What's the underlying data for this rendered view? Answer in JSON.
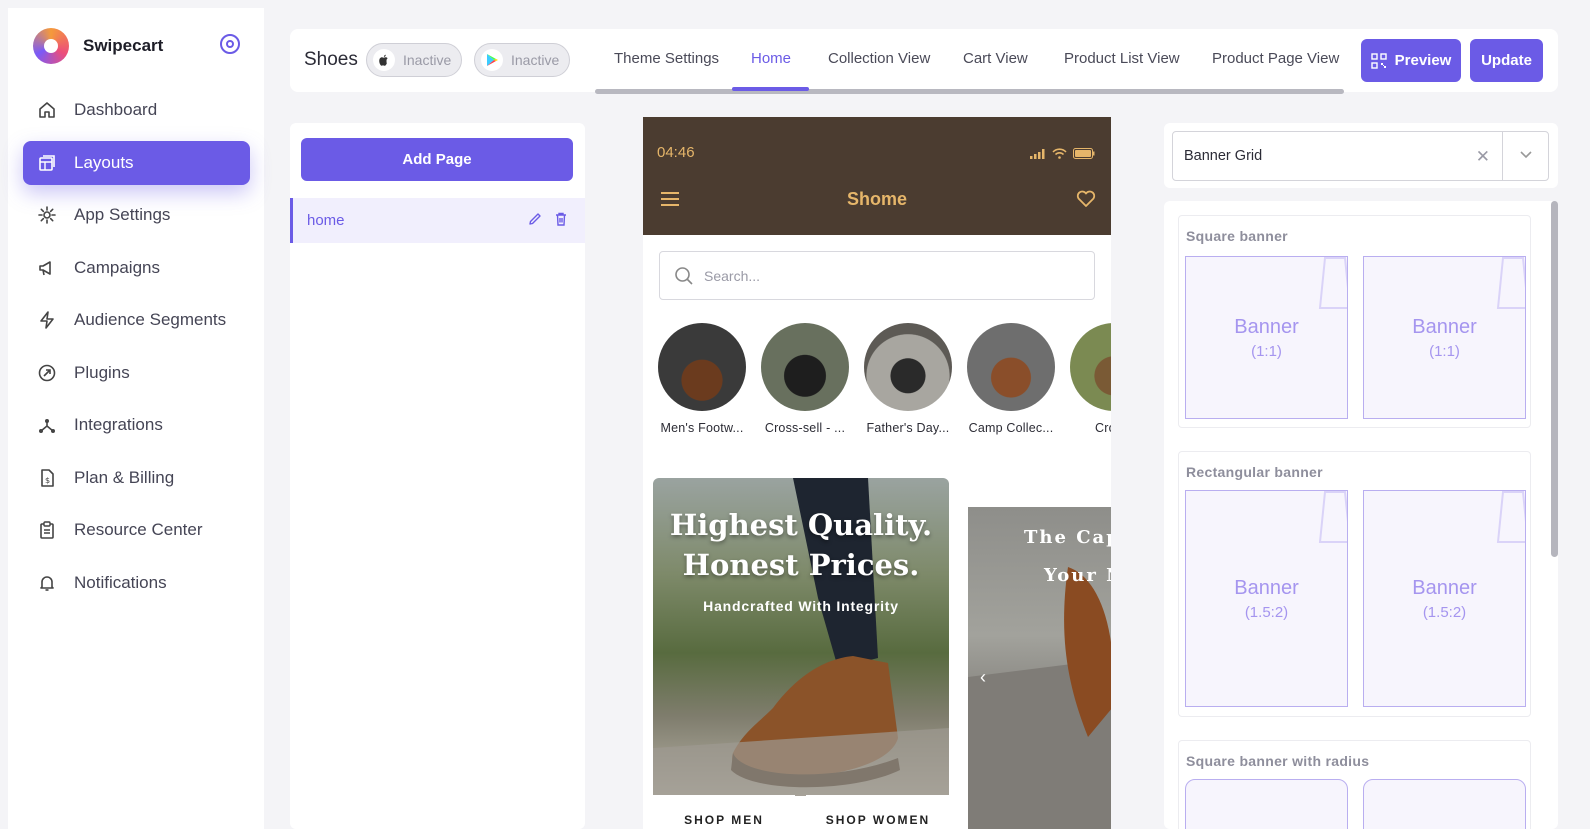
{
  "brand": {
    "name": "Swipecart"
  },
  "sidebar": {
    "items": [
      {
        "label": "Dashboard",
        "icon": "home-icon",
        "active": false
      },
      {
        "label": "Layouts",
        "icon": "layouts-icon",
        "active": true
      },
      {
        "label": "App Settings",
        "icon": "gear-icon",
        "active": false
      },
      {
        "label": "Campaigns",
        "icon": "megaphone-icon",
        "active": false
      },
      {
        "label": "Audience Segments",
        "icon": "lightning-icon",
        "active": false
      },
      {
        "label": "Plugins",
        "icon": "plugin-icon",
        "active": false
      },
      {
        "label": "Integrations",
        "icon": "integrations-icon",
        "active": false
      },
      {
        "label": "Plan & Billing",
        "icon": "billing-icon",
        "active": false
      },
      {
        "label": "Resource Center",
        "icon": "clipboard-icon",
        "active": false
      },
      {
        "label": "Notifications",
        "icon": "bell-icon",
        "active": false
      }
    ]
  },
  "header": {
    "title": "Shoes",
    "ios_status": "Inactive",
    "android_status": "Inactive",
    "tabs": [
      {
        "label": "Theme Settings",
        "active": false
      },
      {
        "label": "Home",
        "active": true
      },
      {
        "label": "Collection View",
        "active": false
      },
      {
        "label": "Cart View",
        "active": false
      },
      {
        "label": "Product List View",
        "active": false
      },
      {
        "label": "Product Page View",
        "active": false
      }
    ],
    "preview_label": "Preview",
    "update_label": "Update"
  },
  "pages": {
    "add_label": "Add Page",
    "items": [
      {
        "label": "home",
        "active": true
      }
    ]
  },
  "phone": {
    "time": "04:46",
    "store_title": "Shome",
    "search_placeholder": "Search...",
    "categories": [
      {
        "label": "Men's Footw..."
      },
      {
        "label": "Cross-sell - ..."
      },
      {
        "label": "Father's Day..."
      },
      {
        "label": "Camp Collec..."
      },
      {
        "label": "Cross-"
      }
    ],
    "banner1": {
      "headline_line1": "Highest Quality.",
      "headline_line2": "Honest Prices.",
      "subline": "Handcrafted With Integrity",
      "shop_men": "SHOP MEN",
      "shop_women": "SHOP WOMEN"
    },
    "banner2": {
      "line1": "The Cap",
      "line2": "Your N"
    }
  },
  "widget_picker": {
    "selected": "Banner Grid",
    "sections": [
      {
        "title": "Square banner",
        "boxes": [
          {
            "label": "Banner",
            "ratio": "(1:1)"
          },
          {
            "label": "Banner",
            "ratio": "(1:1)"
          }
        ]
      },
      {
        "title": "Rectangular banner",
        "boxes": [
          {
            "label": "Banner",
            "ratio": "(1.5:2)"
          },
          {
            "label": "Banner",
            "ratio": "(1.5:2)"
          }
        ]
      },
      {
        "title": "Square banner with radius",
        "boxes": []
      }
    ]
  },
  "colors": {
    "accent": "#6b5be6",
    "phone_header": "#4b3c30",
    "phone_title": "#e6b66a"
  }
}
